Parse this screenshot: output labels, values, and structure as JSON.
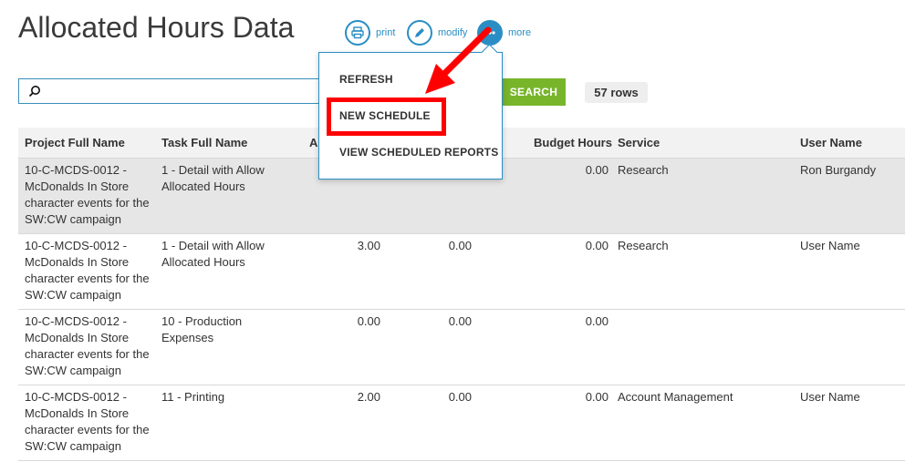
{
  "page": {
    "title": "Allocated Hours Data"
  },
  "actions": {
    "print": "print",
    "modify": "modify",
    "more": "more"
  },
  "search": {
    "value": "",
    "button": "SEARCH",
    "rows": "57 rows"
  },
  "menu": {
    "items": [
      "REFRESH",
      "NEW SCHEDULE",
      "VIEW SCHEDULED REPORTS"
    ]
  },
  "table": {
    "headers": {
      "project": "Project Full Name",
      "task": "Task Full Name",
      "allocated": "A",
      "budget": "Budget Hours",
      "service": "Service",
      "user": "User Name"
    },
    "rows": [
      {
        "project": "10-C-MCDS-0012 - McDonalds In Store character events for the SW:CW campaign",
        "task": "1 - Detail with Allow Allocated Hours",
        "allocated": "",
        "actual": "",
        "budget": "0.00",
        "service": "Research",
        "user": "Ron Burgandy"
      },
      {
        "project": "10-C-MCDS-0012 - McDonalds In Store character events for the SW:CW campaign",
        "task": "1 - Detail with Allow Allocated Hours",
        "allocated": "3.00",
        "actual": "0.00",
        "budget": "0.00",
        "service": "Research",
        "user": "User Name"
      },
      {
        "project": "10-C-MCDS-0012 - McDonalds In Store character events for the SW:CW campaign",
        "task": "10 - Production Expenses",
        "allocated": "0.00",
        "actual": "0.00",
        "budget": "0.00",
        "service": "",
        "user": ""
      },
      {
        "project": "10-C-MCDS-0012 - McDonalds In Store character events for the SW:CW campaign",
        "task": "11 - Printing",
        "allocated": "2.00",
        "actual": "0.00",
        "budget": "0.00",
        "service": "Account Management",
        "user": "User Name"
      }
    ]
  },
  "colors": {
    "accent": "#2a8ec4",
    "search_button": "#79b52b",
    "annotation": "#ff0000"
  },
  "icons": {
    "print": "printer-icon",
    "modify": "pencil-icon",
    "more": "dots-icon",
    "search": "magnifier-icon"
  }
}
